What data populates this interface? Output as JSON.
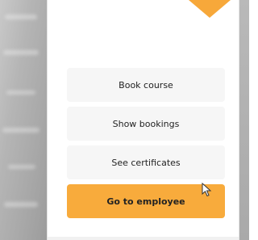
{
  "menu": {
    "book_course": "Book course",
    "show_bookings": "Show bookings",
    "see_certificates": "See certificates",
    "go_to_employee": "Go to employee"
  },
  "colors": {
    "accent": "#f8ab3c",
    "button_bg": "#f6f6f6",
    "panel_bg": "#ffffff"
  },
  "icons": {
    "cursor": "mouse-pointer-icon"
  }
}
